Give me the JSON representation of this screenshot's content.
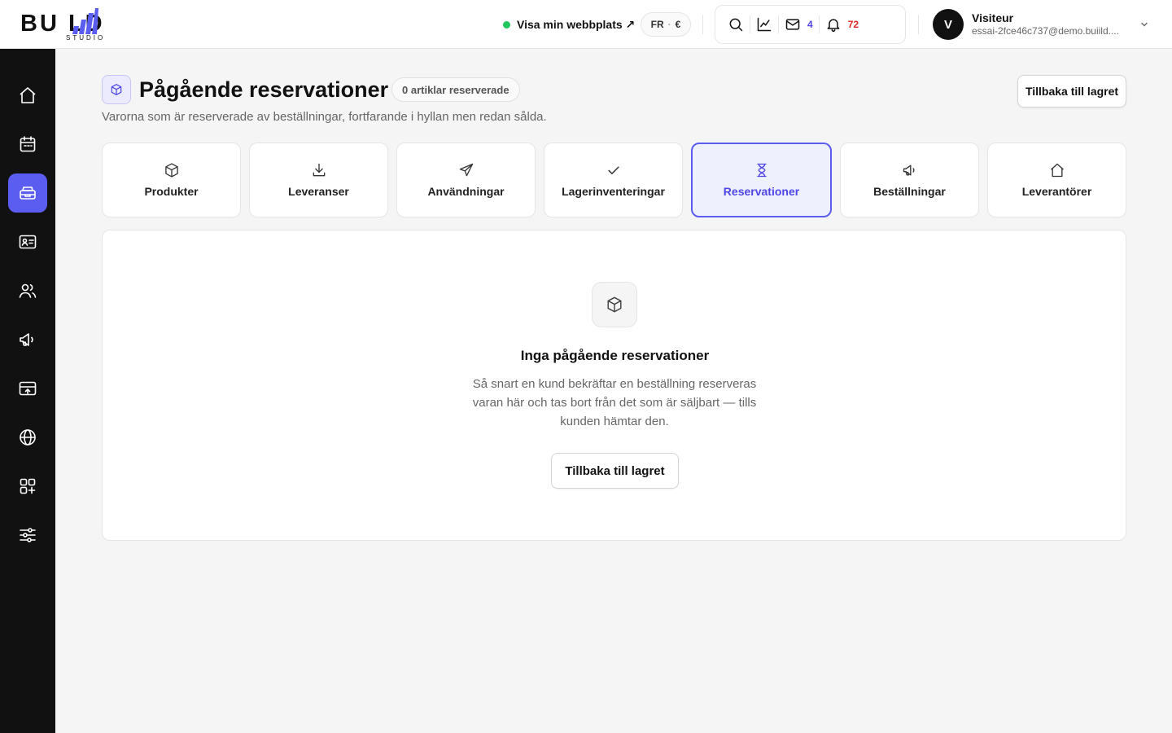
{
  "brand": {
    "logo_text": "BU    LD",
    "logo_sub": "STUDIO",
    "logo_accent_color": "#5b5cf0"
  },
  "topbar": {
    "visit_site_label": "Visa min webbplats ↗",
    "locale": "FR",
    "currency": "€",
    "tools": [
      {
        "icon": "search-icon"
      },
      {
        "icon": "chart-icon"
      },
      {
        "icon": "mail-icon",
        "count": "4"
      },
      {
        "icon": "bell-icon",
        "count": "72"
      }
    ],
    "user": {
      "initial": "V",
      "name": "Visiteur",
      "email": "essai-2fce46c737@demo.buiild...."
    }
  },
  "sidebar": {
    "items": [
      {
        "icon": "home-icon"
      },
      {
        "icon": "calendar-icon"
      },
      {
        "icon": "inventory-icon",
        "active": true
      },
      {
        "icon": "contact-card-icon"
      },
      {
        "icon": "users-icon"
      },
      {
        "icon": "megaphone-icon"
      },
      {
        "icon": "payment-icon"
      },
      {
        "icon": "globe-icon"
      },
      {
        "icon": "apps-icon"
      },
      {
        "icon": "settings-sliders-icon"
      }
    ]
  },
  "header": {
    "title": "Pågående reservationer",
    "badge": "0 artiklar reserverade",
    "subtitle": "Varorna som är reserverade av beställningar, fortfarande i hyllan men redan sålda.",
    "back_button": "Tillbaka till lagret"
  },
  "tabs": [
    {
      "label": "Produkter",
      "icon": "box-icon"
    },
    {
      "label": "Leveranser",
      "icon": "download-icon"
    },
    {
      "label": "Användningar",
      "icon": "send-icon"
    },
    {
      "label": "Lagerinventeringar",
      "icon": "check-icon"
    },
    {
      "label": "Reservationer",
      "icon": "hourglass-icon",
      "active": true
    },
    {
      "label": "Beställningar",
      "icon": "megaphone-icon"
    },
    {
      "label": "Leverantörer",
      "icon": "house-icon"
    }
  ],
  "empty_state": {
    "title": "Inga pågående reservationer",
    "text": "Så snart en kund bekräftar en beställning reserveras varan här och tas bort från det som är säljbart — tills kunden hämtar den.",
    "button": "Tillbaka till lagret"
  }
}
